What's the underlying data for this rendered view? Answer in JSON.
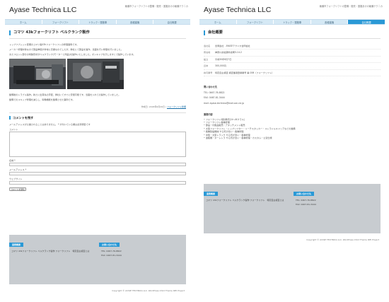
{
  "site": {
    "title": "Ayase Technica LLC",
    "tagline": "綾瀬市フォークリフトの整備・販売・運搬あけの綾瀬テクニカ",
    "copyright": "Copyright © AYASE TECHNICA LLC. WordPress Child Theme IKEI Project"
  },
  "nav": [
    "ホーム",
    "フォークリフト",
    "トラック・運搬車",
    "各種建機",
    "会社概要"
  ],
  "left": {
    "post_title": "コマツ 43kフォークリフト ベルクランク製作",
    "intro": [
      "トップフブレッド装備のコマツ製43kフォークリフトの修理事例です。",
      "メーカー修理対象なので部品単価が非常に高額なのでしたが、弊社にて部品を製作、当面を行い修理を行いました。",
      "またフロント部分の特殊形状がベルクランク(モーターと同品)を製作いたしました。ポンキャブを示しますとで製作しています。"
    ],
    "outro": [
      "整備後のトラブル製作。新たに出荷先の手配、弊社にてすぐに安価可能です、当面を入れての製作していました。",
      "整備でのスキップ修理を減らし、稼働機能を整備させた事例です。"
    ],
    "meta": "作成日: 2018年6月20日 / ",
    "meta_link": "フォークリフト整備",
    "reply_title": "コメントを残す",
    "reply_note": "メールアドレスが公開されることはありません。 * が付いている欄は必須項目です",
    "comment_label": "コメント",
    "name_label": "名前 *",
    "email_label": "メールアドレス *",
    "website_label": "ウェブサイト",
    "submit": "コメントを送信"
  },
  "right": {
    "page_title": "会社概要",
    "company_rows": [
      {
        "k": "会社名",
        "v": "合同会社　AYASEテクニカ合同会社"
      },
      {
        "k": "所在地",
        "v": "神奈川県綾瀬市吉岡5-14-2"
      },
      {
        "k": "設立",
        "v": "平成30年6月7日"
      },
      {
        "k": "資本",
        "v": "300,000円"
      },
      {
        "k": "許可番号",
        "v": "特定自主検査 検査業者登録番号 第-006（フォークリフト）"
      }
    ],
    "contact_title": "問い合わせ先",
    "contact_lines": [
      "TEL: 0467-76-8822",
      "FAX: 0467-81-3444",
      "mail: ayase-technica@mail.ocn.ne.jp"
    ],
    "business_title": "業務内容",
    "business_items": [
      "フォークリフト特別教育(1t～4tクラス)",
      "フォークリフト各種修理",
      "部品・付属品販売・アタッチメント販売",
      "大型フォークリフト・トップリフター・リーチスタッカー・ストラドルキャリアなどの整備",
      "各種建設機械 やる気が合い・各種修理",
      "中型・大型トラック やる気が合い・各種修理",
      "運搬機・ターレトラ やる気が合い・各種修理・カスタム・公道仕様"
    ]
  },
  "widgets": {
    "w1_title": "業務概要",
    "w1_body": "コマツ 43kフォークリフト ベルクランク製作 フォークリフト　特定自主検査とは",
    "w2_title": "お問い合わせ先",
    "w2_tel": "TEL: 0467-76-8822",
    "w2_fax": "FAX: 0467-81-3444"
  },
  "colors": {
    "accent": "#2a99d6",
    "nav_bg": "#d5e9f5",
    "footer_bg": "#c8ccd0"
  }
}
